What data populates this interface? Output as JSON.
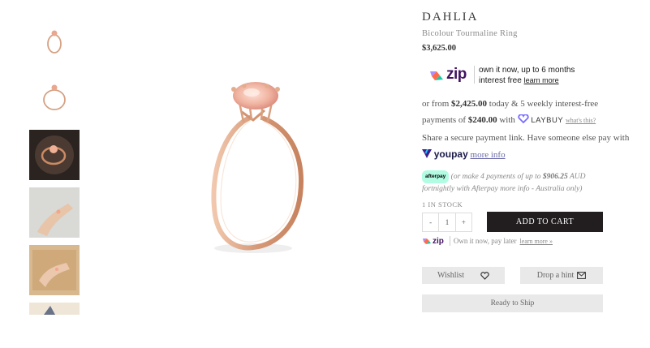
{
  "product": {
    "name": "DAHLIA",
    "subtitle": "Bicolour Tourmaline Ring",
    "price": "$3,625.00"
  },
  "zip": {
    "logo_text": "zip",
    "line1": "own it now, up to 6 months",
    "line2": "interest free",
    "learn_more": "learn more"
  },
  "laybuy": {
    "prefix": "or from",
    "amount_today": "$2,425.00",
    "mid": "today & 5 weekly interest-free payments of",
    "weekly_amount": "$240.00",
    "with": "with",
    "logo_text": "LAYBUY",
    "whats_this": "what's this?"
  },
  "youpay": {
    "text": "Share a secure payment link. Have someone else pay with",
    "logo_text": "youpay",
    "more_info": "more info"
  },
  "afterpay": {
    "badge": "afterpay",
    "text_prefix": "(or make 4 payments of up to",
    "amount": "$906.25",
    "text_suffix": "AUD fortnightly with Afterpay more info - Australia only)"
  },
  "stock": "1 IN STOCK",
  "quantity": {
    "minus": "-",
    "value": "1",
    "plus": "+"
  },
  "add_to_cart": "ADD TO CART",
  "zip_small": {
    "logo_text": "zip",
    "text": "Own it now, pay later",
    "learn_more": "learn more »"
  },
  "wishlist": "Wishlist",
  "drop_hint": "Drop a hint",
  "ready_to_ship": "Ready to Ship",
  "colors": {
    "rose_gold": "#d9a98a",
    "zip_purple": "#411361",
    "zip_orange": "#ff6b4a",
    "laybuy_purple": "#786dff",
    "afterpay_mint": "#b2fce4"
  }
}
